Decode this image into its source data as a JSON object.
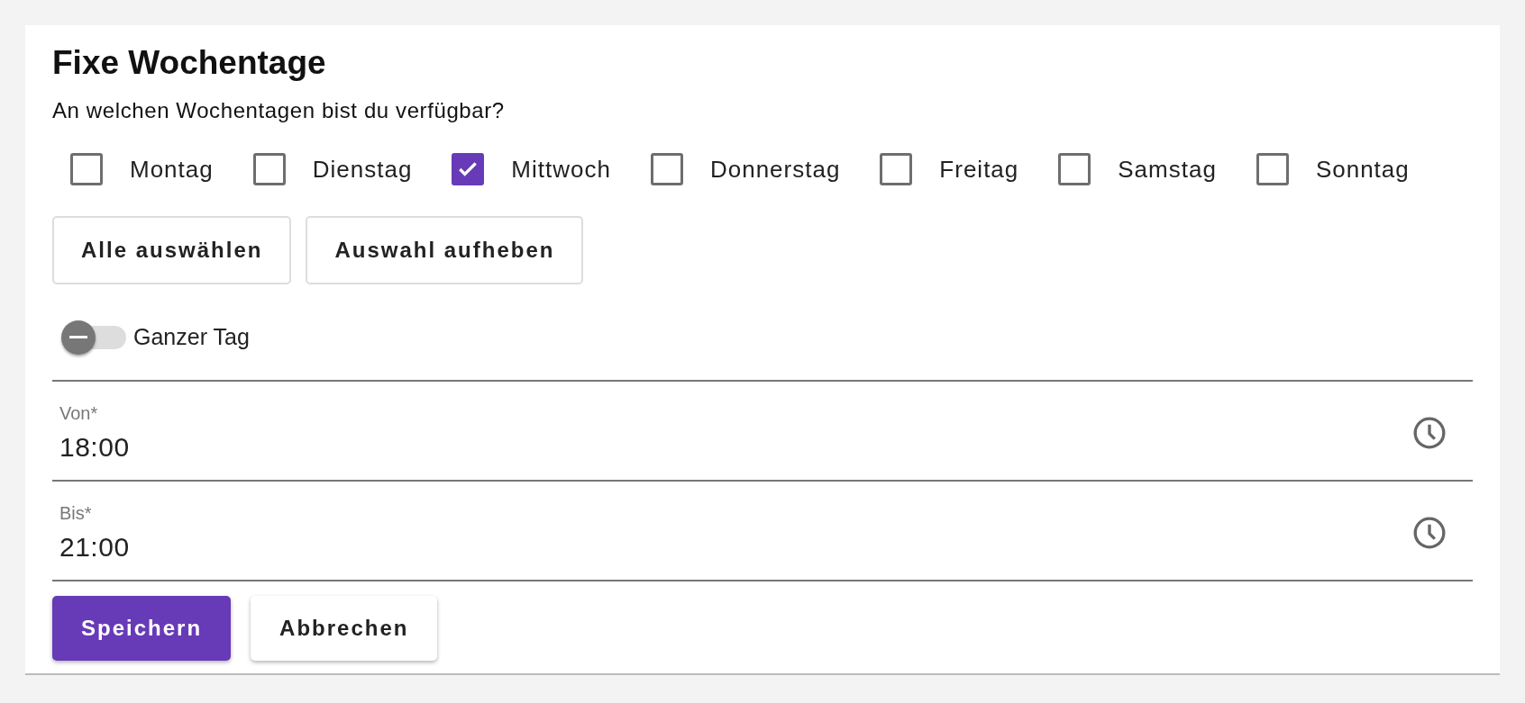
{
  "title": "Fixe Wochentage",
  "question": "An welchen Wochentagen bist du verfügbar?",
  "days": [
    {
      "label": "Montag",
      "checked": false
    },
    {
      "label": "Dienstag",
      "checked": false
    },
    {
      "label": "Mittwoch",
      "checked": true
    },
    {
      "label": "Donnerstag",
      "checked": false
    },
    {
      "label": "Freitag",
      "checked": false
    },
    {
      "label": "Samstag",
      "checked": false
    },
    {
      "label": "Sonntag",
      "checked": false
    }
  ],
  "selection_buttons": [
    "Alle auswählen",
    "Auswahl aufheben"
  ],
  "all_day": {
    "label": "Ganzer Tag",
    "on": false
  },
  "fields": [
    {
      "label": "Von*",
      "value": "18:00"
    },
    {
      "label": "Bis*",
      "value": "21:00"
    }
  ],
  "actions": [
    {
      "label": "Speichern",
      "kind": "primary"
    },
    {
      "label": "Abbrechen",
      "kind": "secondary"
    }
  ]
}
